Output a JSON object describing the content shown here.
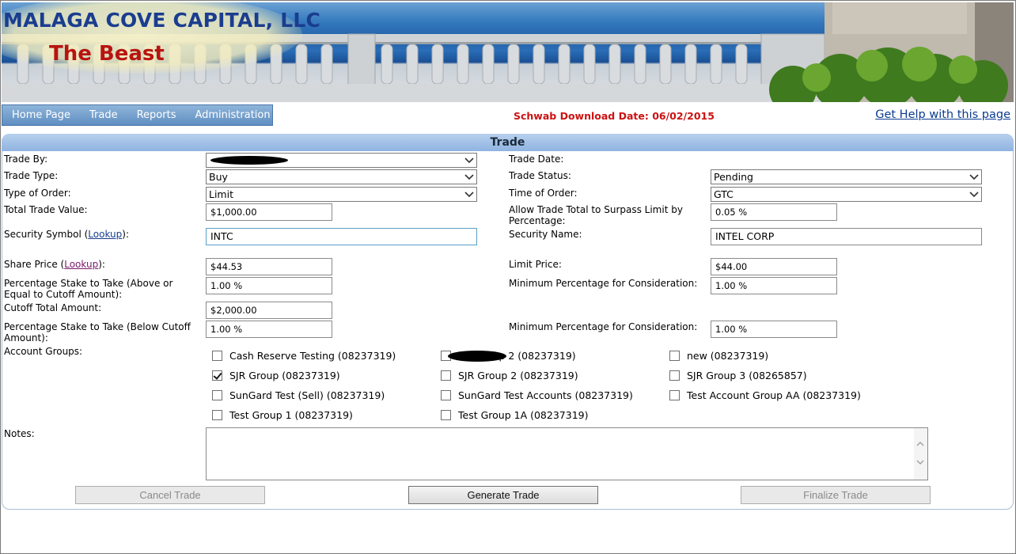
{
  "banner": {
    "company": "MALAGA COVE CAPITAL, LLC",
    "app": "The Beast"
  },
  "nav": {
    "items": [
      "Home Page",
      "Trade",
      "Reports",
      "Administration"
    ]
  },
  "download_date": "Schwab Download Date: 06/02/2015",
  "help_link": "Get Help with this page",
  "panel_title": "Trade",
  "form": {
    "trade_by_label": "Trade By:",
    "trade_date_label": "Trade Date:",
    "trade_type_label": "Trade Type:",
    "trade_type_value": "Buy",
    "trade_status_label": "Trade Status:",
    "trade_status_value": "Pending",
    "order_type_label": "Type of Order:",
    "order_type_value": "Limit",
    "order_time_label": "Time of Order:",
    "order_time_value": "GTC",
    "total_value_label": "Total Trade Value:",
    "total_value": "$1,000.00",
    "surpass_label": "Allow Trade Total to Surpass Limit by Percentage:",
    "surpass_value": "0.05 %",
    "symbol_label_pre": "Security Symbol (",
    "lookup": "Lookup",
    "symbol_label_post": "):",
    "symbol_value": "INTC",
    "security_name_label": "Security Name:",
    "security_name_value": "INTEL CORP",
    "share_price_label_pre": "Share Price (",
    "share_price_label_post": "):",
    "share_price_value": "$44.53",
    "limit_price_label": "Limit Price:",
    "limit_price_value": "$44.00",
    "stake_above_label": "Percentage Stake to Take (Above or Equal to Cutoff Amount):",
    "stake_above_value": "1.00 %",
    "min_pct_label_1": "Minimum Percentage for Consideration:",
    "min_pct_value_1": "1.00 %",
    "cutoff_label": "Cutoff Total Amount:",
    "cutoff_value": "$2,000.00",
    "stake_below_label": "Percentage Stake to Take (Below Cutoff Amount):",
    "stake_below_value": "1.00 %",
    "min_pct_label_2": "Minimum Percentage for Consideration:",
    "min_pct_value_2": "1.00 %",
    "account_groups_label": "Account Groups:",
    "notes_label": "Notes:"
  },
  "account_groups": [
    {
      "label": "Cash Reserve Testing (08237319)",
      "checked": false
    },
    {
      "label": "est group 2 (08237319)",
      "checked": false
    },
    {
      "label": "new (08237319)",
      "checked": false
    },
    {
      "label": "SJR Group (08237319)",
      "checked": true
    },
    {
      "label": "SJR Group 2 (08237319)",
      "checked": false
    },
    {
      "label": "SJR Group 3 (08265857)",
      "checked": false
    },
    {
      "label": "SunGard Test (Sell) (08237319)",
      "checked": false
    },
    {
      "label": "SunGard Test Accounts (08237319)",
      "checked": false
    },
    {
      "label": "Test Account Group AA (08237319)",
      "checked": false
    },
    {
      "label": "Test Group 1 (08237319)",
      "checked": false
    },
    {
      "label": "Test Group 1A (08237319)",
      "checked": false
    }
  ],
  "buttons": {
    "cancel": "Cancel Trade",
    "generate": "Generate Trade",
    "finalize": "Finalize Trade"
  }
}
